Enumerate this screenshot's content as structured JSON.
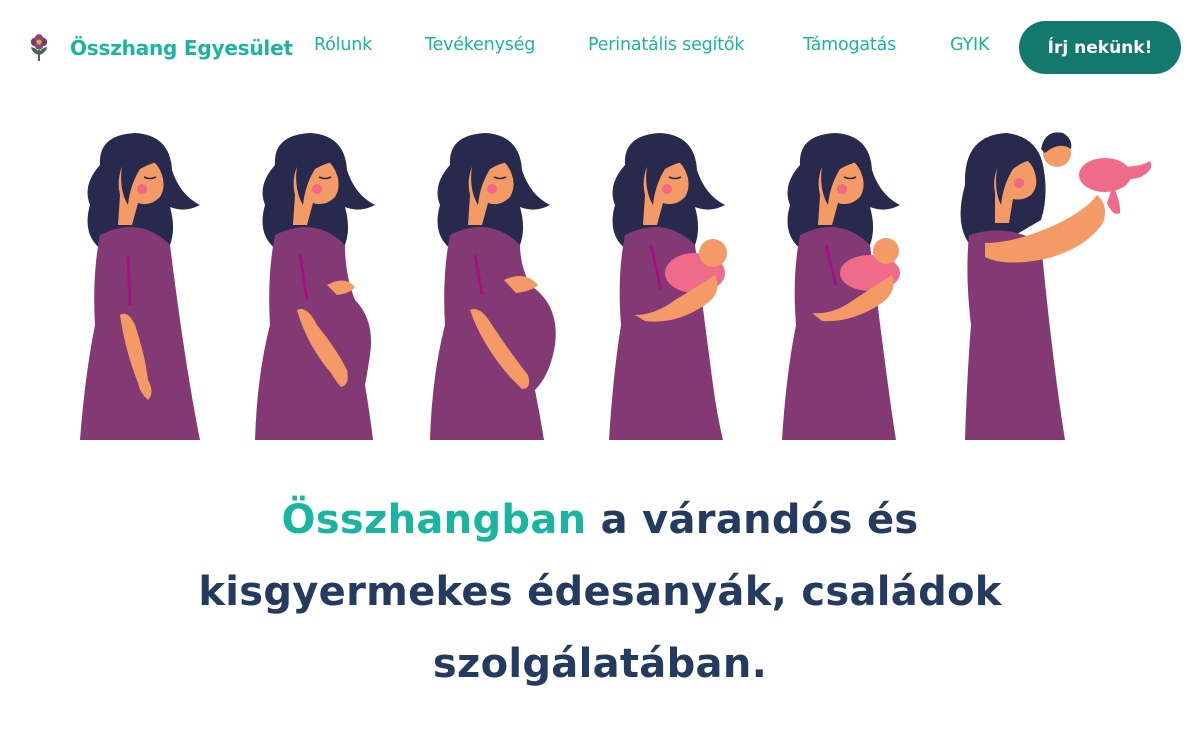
{
  "brand": {
    "name": "Összhang Egyesület",
    "logo_icon": "flower-logo-icon"
  },
  "nav": {
    "items": [
      {
        "label": "Rólunk"
      },
      {
        "label": "Tevékenység"
      },
      {
        "label": "Perinatális segítők"
      },
      {
        "label": "Támogatás"
      },
      {
        "label": "GYIK"
      }
    ],
    "cta_label": "Írj nekünk!"
  },
  "hero": {
    "illustration": "pregnancy-to-motherhood-illustration",
    "headline_accent": "Összhangban",
    "headline_line1_rest": " a várandós és",
    "headline_line2": "kisgyermekes édesanyák, családok",
    "headline_line3": "szolgálatában."
  },
  "colors": {
    "accent": "#1ab5a0",
    "cta_bg": "#13796c",
    "headline": "#243a5e",
    "dress": "#833a74",
    "hair": "#27294d",
    "skin": "#f39a66",
    "baby": "#f06b8a"
  }
}
